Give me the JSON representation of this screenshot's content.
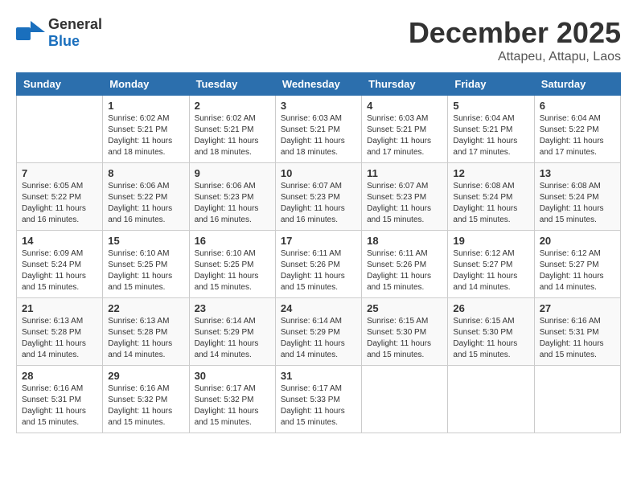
{
  "logo": {
    "general": "General",
    "blue": "Blue"
  },
  "title": "December 2025",
  "subtitle": "Attapeu, Attapu, Laos",
  "weekdays": [
    "Sunday",
    "Monday",
    "Tuesday",
    "Wednesday",
    "Thursday",
    "Friday",
    "Saturday"
  ],
  "weeks": [
    [
      {
        "day": "",
        "sunrise": "",
        "sunset": "",
        "daylight": ""
      },
      {
        "day": "1",
        "sunrise": "Sunrise: 6:02 AM",
        "sunset": "Sunset: 5:21 PM",
        "daylight": "Daylight: 11 hours and 18 minutes."
      },
      {
        "day": "2",
        "sunrise": "Sunrise: 6:02 AM",
        "sunset": "Sunset: 5:21 PM",
        "daylight": "Daylight: 11 hours and 18 minutes."
      },
      {
        "day": "3",
        "sunrise": "Sunrise: 6:03 AM",
        "sunset": "Sunset: 5:21 PM",
        "daylight": "Daylight: 11 hours and 18 minutes."
      },
      {
        "day": "4",
        "sunrise": "Sunrise: 6:03 AM",
        "sunset": "Sunset: 5:21 PM",
        "daylight": "Daylight: 11 hours and 17 minutes."
      },
      {
        "day": "5",
        "sunrise": "Sunrise: 6:04 AM",
        "sunset": "Sunset: 5:21 PM",
        "daylight": "Daylight: 11 hours and 17 minutes."
      },
      {
        "day": "6",
        "sunrise": "Sunrise: 6:04 AM",
        "sunset": "Sunset: 5:22 PM",
        "daylight": "Daylight: 11 hours and 17 minutes."
      }
    ],
    [
      {
        "day": "7",
        "sunrise": "Sunrise: 6:05 AM",
        "sunset": "Sunset: 5:22 PM",
        "daylight": "Daylight: 11 hours and 16 minutes."
      },
      {
        "day": "8",
        "sunrise": "Sunrise: 6:06 AM",
        "sunset": "Sunset: 5:22 PM",
        "daylight": "Daylight: 11 hours and 16 minutes."
      },
      {
        "day": "9",
        "sunrise": "Sunrise: 6:06 AM",
        "sunset": "Sunset: 5:23 PM",
        "daylight": "Daylight: 11 hours and 16 minutes."
      },
      {
        "day": "10",
        "sunrise": "Sunrise: 6:07 AM",
        "sunset": "Sunset: 5:23 PM",
        "daylight": "Daylight: 11 hours and 16 minutes."
      },
      {
        "day": "11",
        "sunrise": "Sunrise: 6:07 AM",
        "sunset": "Sunset: 5:23 PM",
        "daylight": "Daylight: 11 hours and 15 minutes."
      },
      {
        "day": "12",
        "sunrise": "Sunrise: 6:08 AM",
        "sunset": "Sunset: 5:24 PM",
        "daylight": "Daylight: 11 hours and 15 minutes."
      },
      {
        "day": "13",
        "sunrise": "Sunrise: 6:08 AM",
        "sunset": "Sunset: 5:24 PM",
        "daylight": "Daylight: 11 hours and 15 minutes."
      }
    ],
    [
      {
        "day": "14",
        "sunrise": "Sunrise: 6:09 AM",
        "sunset": "Sunset: 5:24 PM",
        "daylight": "Daylight: 11 hours and 15 minutes."
      },
      {
        "day": "15",
        "sunrise": "Sunrise: 6:10 AM",
        "sunset": "Sunset: 5:25 PM",
        "daylight": "Daylight: 11 hours and 15 minutes."
      },
      {
        "day": "16",
        "sunrise": "Sunrise: 6:10 AM",
        "sunset": "Sunset: 5:25 PM",
        "daylight": "Daylight: 11 hours and 15 minutes."
      },
      {
        "day": "17",
        "sunrise": "Sunrise: 6:11 AM",
        "sunset": "Sunset: 5:26 PM",
        "daylight": "Daylight: 11 hours and 15 minutes."
      },
      {
        "day": "18",
        "sunrise": "Sunrise: 6:11 AM",
        "sunset": "Sunset: 5:26 PM",
        "daylight": "Daylight: 11 hours and 15 minutes."
      },
      {
        "day": "19",
        "sunrise": "Sunrise: 6:12 AM",
        "sunset": "Sunset: 5:27 PM",
        "daylight": "Daylight: 11 hours and 14 minutes."
      },
      {
        "day": "20",
        "sunrise": "Sunrise: 6:12 AM",
        "sunset": "Sunset: 5:27 PM",
        "daylight": "Daylight: 11 hours and 14 minutes."
      }
    ],
    [
      {
        "day": "21",
        "sunrise": "Sunrise: 6:13 AM",
        "sunset": "Sunset: 5:28 PM",
        "daylight": "Daylight: 11 hours and 14 minutes."
      },
      {
        "day": "22",
        "sunrise": "Sunrise: 6:13 AM",
        "sunset": "Sunset: 5:28 PM",
        "daylight": "Daylight: 11 hours and 14 minutes."
      },
      {
        "day": "23",
        "sunrise": "Sunrise: 6:14 AM",
        "sunset": "Sunset: 5:29 PM",
        "daylight": "Daylight: 11 hours and 14 minutes."
      },
      {
        "day": "24",
        "sunrise": "Sunrise: 6:14 AM",
        "sunset": "Sunset: 5:29 PM",
        "daylight": "Daylight: 11 hours and 14 minutes."
      },
      {
        "day": "25",
        "sunrise": "Sunrise: 6:15 AM",
        "sunset": "Sunset: 5:30 PM",
        "daylight": "Daylight: 11 hours and 15 minutes."
      },
      {
        "day": "26",
        "sunrise": "Sunrise: 6:15 AM",
        "sunset": "Sunset: 5:30 PM",
        "daylight": "Daylight: 11 hours and 15 minutes."
      },
      {
        "day": "27",
        "sunrise": "Sunrise: 6:16 AM",
        "sunset": "Sunset: 5:31 PM",
        "daylight": "Daylight: 11 hours and 15 minutes."
      }
    ],
    [
      {
        "day": "28",
        "sunrise": "Sunrise: 6:16 AM",
        "sunset": "Sunset: 5:31 PM",
        "daylight": "Daylight: 11 hours and 15 minutes."
      },
      {
        "day": "29",
        "sunrise": "Sunrise: 6:16 AM",
        "sunset": "Sunset: 5:32 PM",
        "daylight": "Daylight: 11 hours and 15 minutes."
      },
      {
        "day": "30",
        "sunrise": "Sunrise: 6:17 AM",
        "sunset": "Sunset: 5:32 PM",
        "daylight": "Daylight: 11 hours and 15 minutes."
      },
      {
        "day": "31",
        "sunrise": "Sunrise: 6:17 AM",
        "sunset": "Sunset: 5:33 PM",
        "daylight": "Daylight: 11 hours and 15 minutes."
      },
      {
        "day": "",
        "sunrise": "",
        "sunset": "",
        "daylight": ""
      },
      {
        "day": "",
        "sunrise": "",
        "sunset": "",
        "daylight": ""
      },
      {
        "day": "",
        "sunrise": "",
        "sunset": "",
        "daylight": ""
      }
    ]
  ]
}
